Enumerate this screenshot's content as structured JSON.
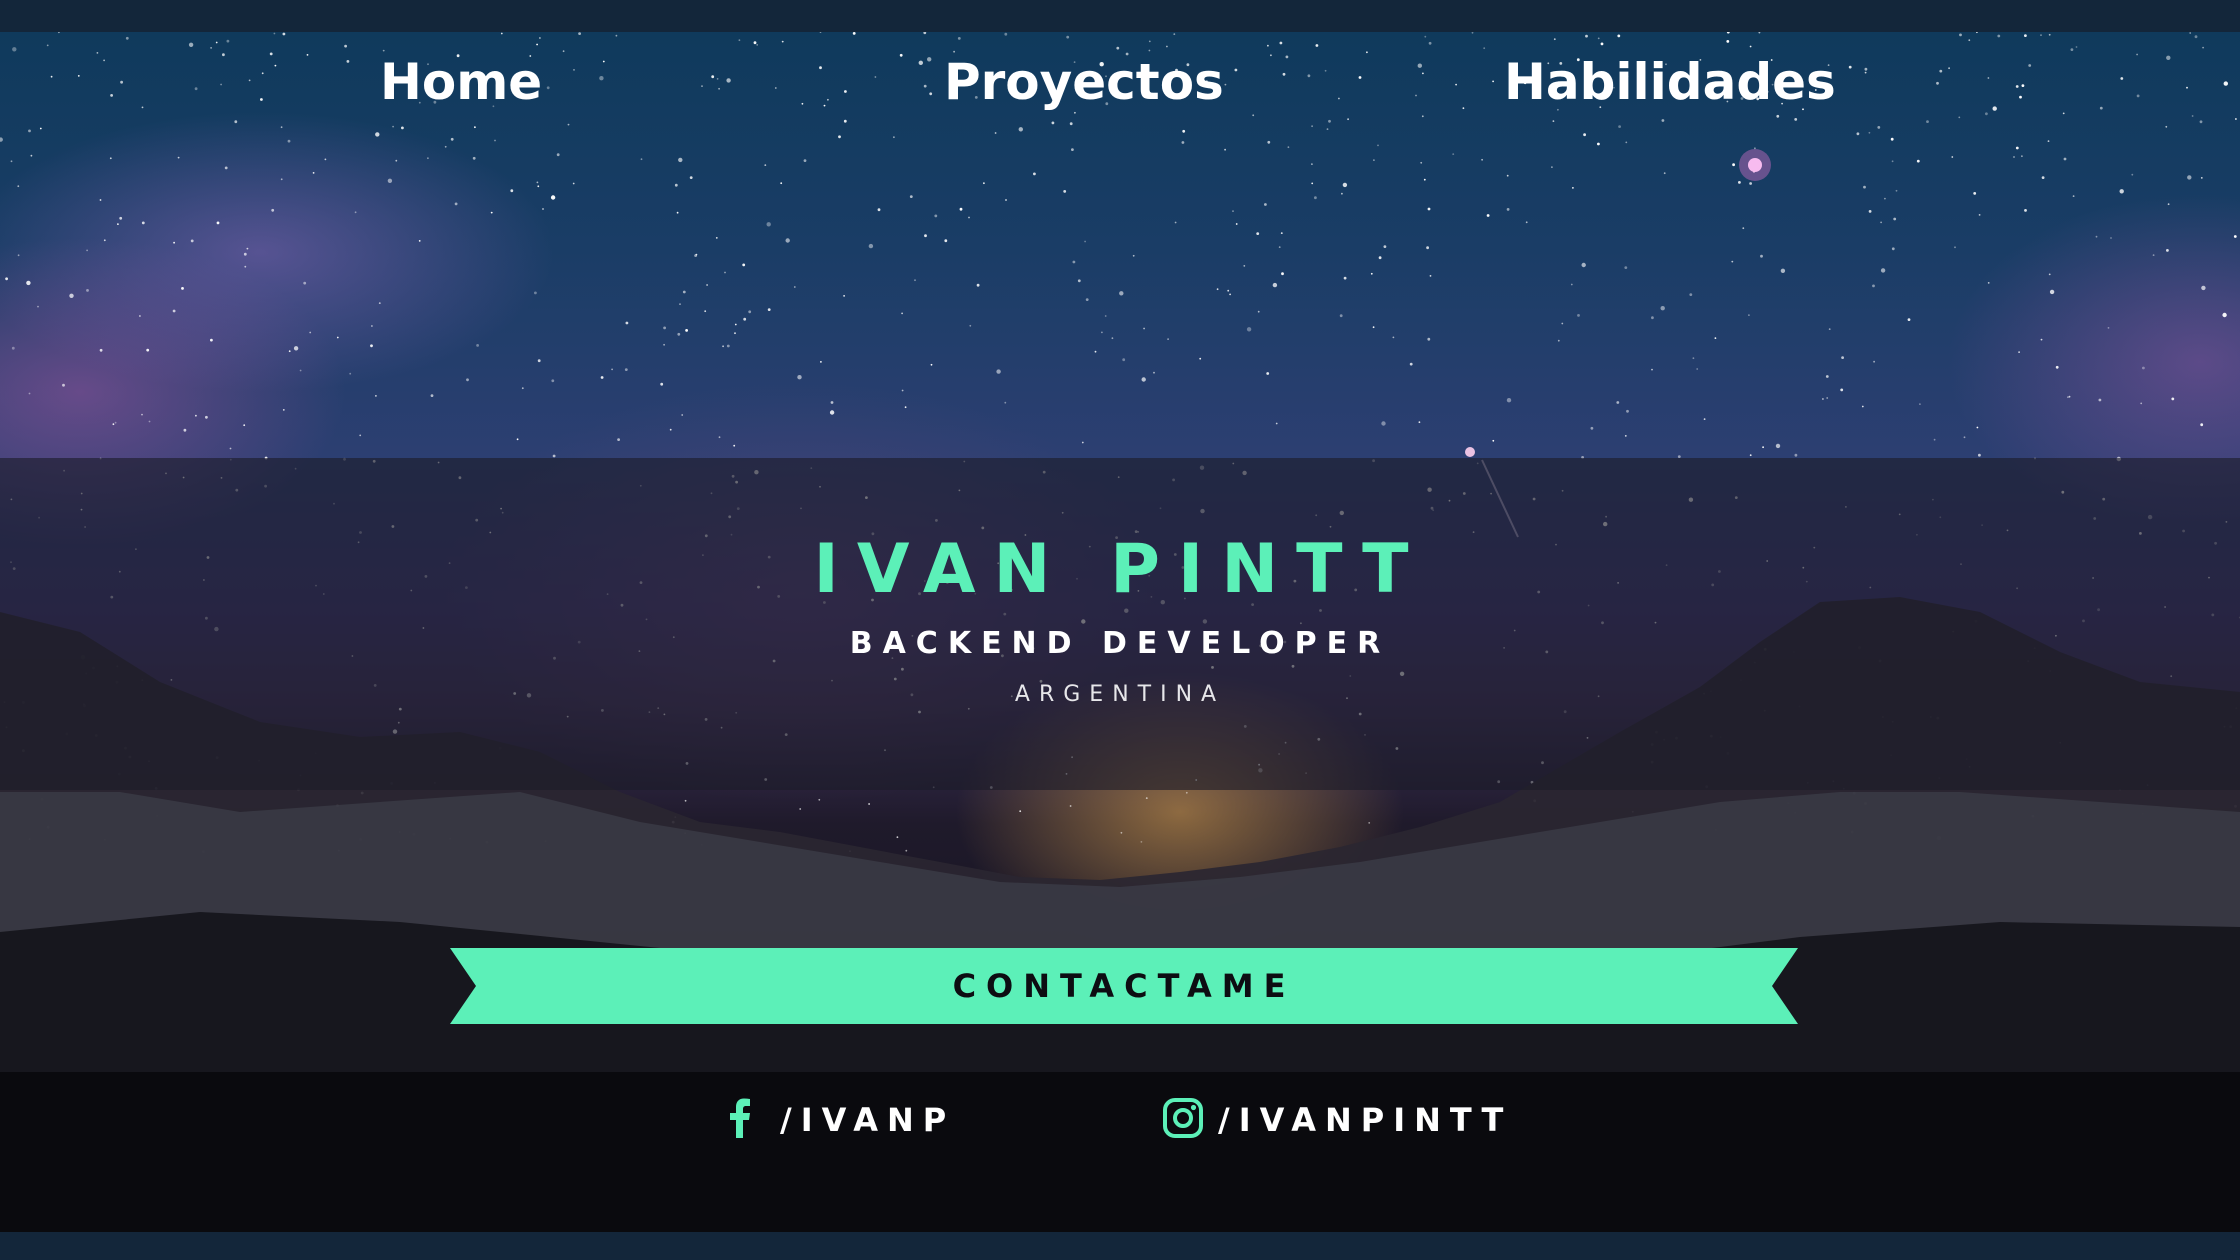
{
  "nav": {
    "home": "Home",
    "projects": "Proyectos",
    "skills": "Habilidades"
  },
  "hero": {
    "name": "IVAN PINTT",
    "role": "BACKEND DEVELOPER",
    "country": "ARGENTINA"
  },
  "cta": {
    "label": "CONTACTAME"
  },
  "social": {
    "facebook": {
      "icon": "facebook-icon",
      "handle": "/IVANP"
    },
    "instagram": {
      "icon": "instagram-icon",
      "handle": "/IVANPINTT"
    }
  },
  "colors": {
    "accent": "#5cf0b8",
    "bar": "#13263a",
    "text": "#ffffff"
  }
}
